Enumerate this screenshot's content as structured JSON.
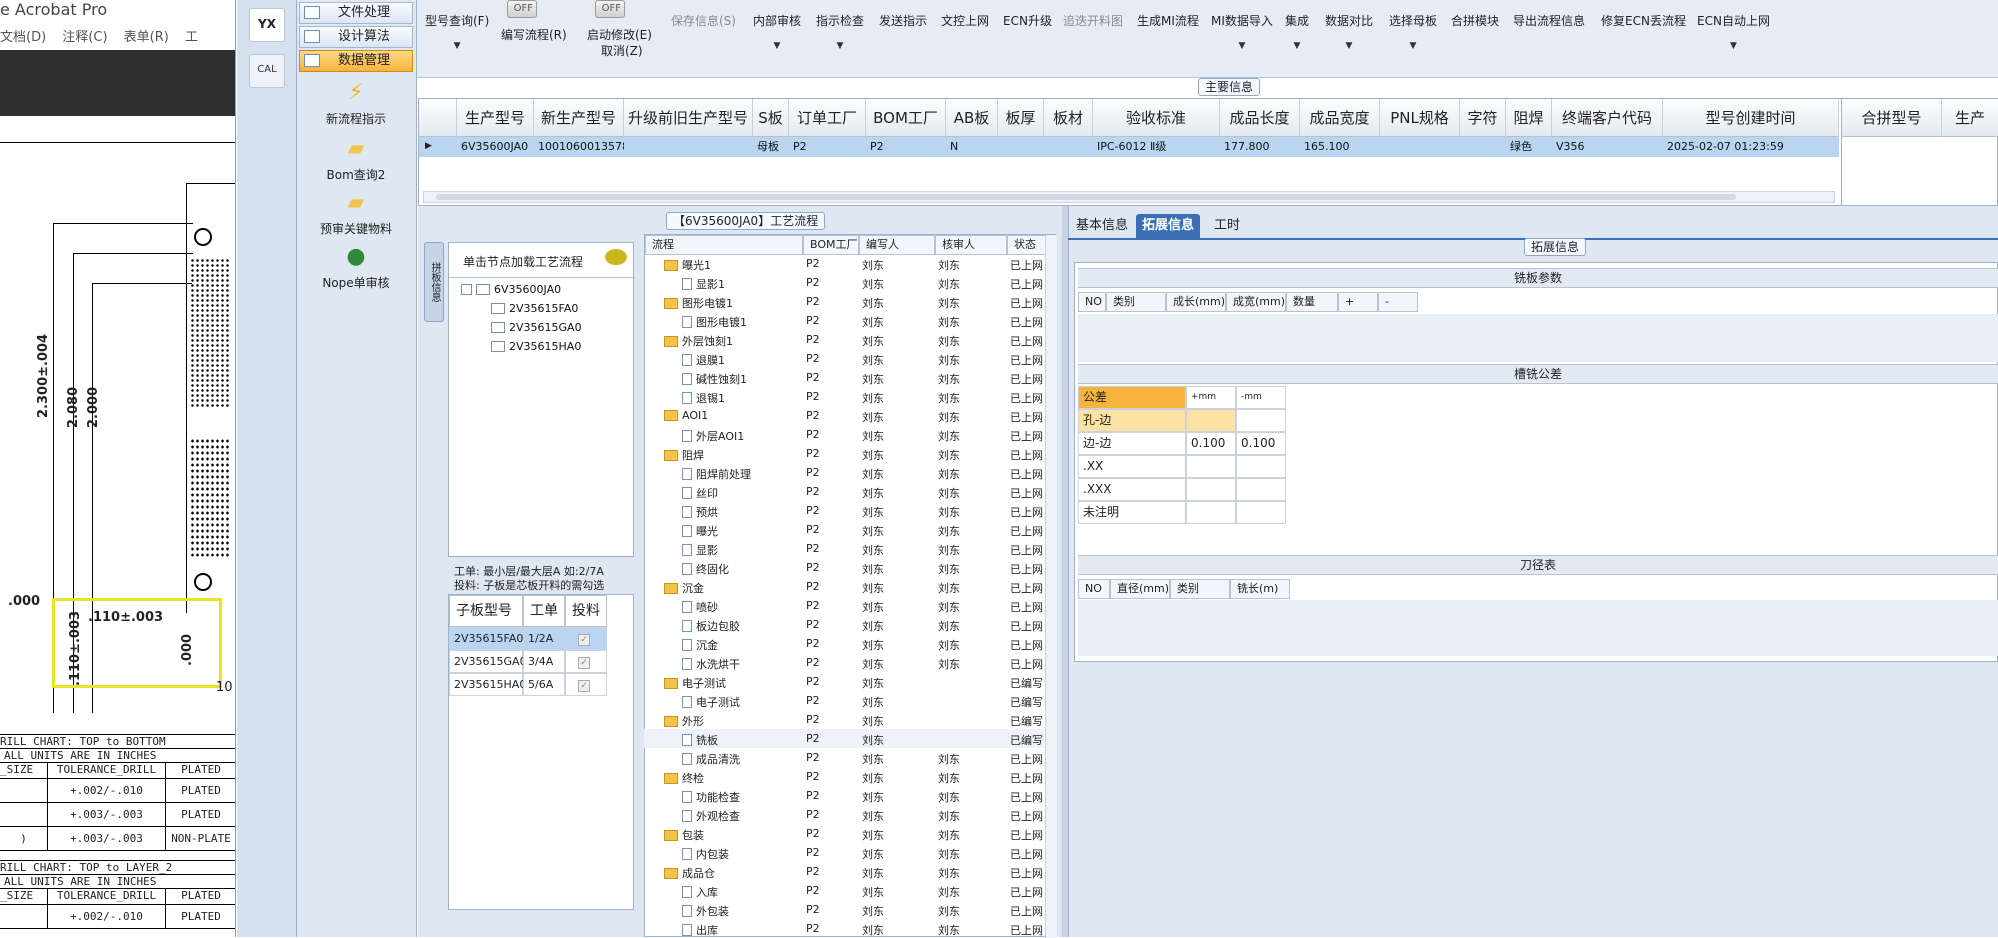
{
  "acrobat": {
    "title": "e Acrobat Pro",
    "menu": [
      "文档(D)",
      "注释(C)",
      "表单(R)",
      "工"
    ],
    "dims": {
      "d1": "2.300±.004",
      "d2": "2.080",
      "d3": "2.000",
      "d4": ".000",
      "d5": ".110±.003",
      "d6": ".110±.003",
      "d7": ".000",
      "d8": "10"
    },
    "chart1": {
      "title": "RILL CHART: TOP to BOTTOM",
      "units": "ALL UNITS ARE IN INCHES",
      "headers": [
        "_SIZE",
        "TOLERANCE_DRILL",
        "PLATED"
      ],
      "rows": [
        [
          "",
          "+.002/-.010",
          "PLATED"
        ],
        [
          "",
          "+.003/-.003",
          "PLATED"
        ],
        [
          ")",
          "+.003/-.003",
          "NON-PLATE"
        ]
      ]
    },
    "chart2": {
      "title": "RILL CHART: TOP to LAYER_2",
      "units": "ALL UNITS ARE IN INCHES",
      "headers": [
        "_SIZE",
        "TOLERANCE_DRILL",
        "PLATED"
      ],
      "rows": [
        [
          "",
          "+.002/-.010",
          "PLATED"
        ]
      ]
    }
  },
  "launcher": {
    "yx": "YX",
    "calc": "CAL"
  },
  "nav": {
    "buttons": [
      "文件处理",
      "设计算法",
      "数据管理"
    ],
    "tools": [
      "新流程指示",
      "Bom查询2",
      "预审关键物料",
      "Nope单审核"
    ]
  },
  "toolbar": {
    "items": [
      "型号查询(F)",
      "编写流程(R)",
      "启动修改(E)",
      "取消(Z)",
      "保存信息(S)",
      "内部审核",
      "指示检查",
      "发送指示",
      "文控上网",
      "ECN升级",
      "追迭开料图",
      "生成MI流程",
      "MI数据导入",
      "集成",
      "数据对比",
      "选择母板",
      "合拼模块",
      "导出流程信息",
      "修复ECN丢流程",
      "ECN自动上网"
    ],
    "toggle": "OFF"
  },
  "main": {
    "title": "主要信息",
    "headers": [
      "生产型号",
      "新生产型号",
      "升级前旧生产型号",
      "S板",
      "订单工厂",
      "BOM工厂",
      "AB板",
      "板厚",
      "板材",
      "验收标准",
      "成品长度",
      "成品宽度",
      "PNL规格",
      "字符",
      "阻焊",
      "终端客户代码",
      "型号创建时间"
    ],
    "row": [
      "6V35600JA0",
      "10010600135780",
      "",
      "母板",
      "P2",
      "P2",
      "N",
      "",
      "",
      "IPC-6012 Ⅱ级",
      "177.800",
      "165.100",
      "",
      "",
      "绿色",
      "V356",
      "2025-02-07 01:23:59"
    ],
    "right_headers": [
      "合拼型号",
      "生产"
    ]
  },
  "process": {
    "title": "【6V35600JA0】工艺流程",
    "hint": "单击节点加载工艺流程",
    "sidetab": "拼板信息",
    "tree_root": "6V35600JA0",
    "tree_children": [
      "2V35615FA0",
      "2V35615GA0",
      "2V35615HA0"
    ],
    "info1": "工单: 最小层/最大层A 如:2/7A",
    "info2": "投料: 子板是芯板开料的需勾选",
    "sub_headers": [
      "子板型号",
      "工单",
      "投料"
    ],
    "sub_rows": [
      [
        "2V35615FA0",
        "1/2A"
      ],
      [
        "2V35615GA0",
        "3/4A"
      ],
      [
        "2V35615HA0",
        "5/6A"
      ]
    ],
    "flow_headers": [
      "流程",
      "BOM工厂",
      "编写人",
      "核审人",
      "状态"
    ],
    "flow_rows": [
      {
        "t": "f",
        "n": "曝光1",
        "b": "P2",
        "w": "刘东",
        "r": "刘东",
        "s": "已上网"
      },
      {
        "t": "d",
        "n": "显影1",
        "b": "P2",
        "w": "刘东",
        "r": "刘东",
        "s": "已上网"
      },
      {
        "t": "f",
        "n": "图形电镀1",
        "b": "P2",
        "w": "刘东",
        "r": "刘东",
        "s": "已上网"
      },
      {
        "t": "d",
        "n": "图形电镀1",
        "b": "P2",
        "w": "刘东",
        "r": "刘东",
        "s": "已上网"
      },
      {
        "t": "f",
        "n": "外层蚀刻1",
        "b": "P2",
        "w": "刘东",
        "r": "刘东",
        "s": "已上网"
      },
      {
        "t": "d",
        "n": "退膜1",
        "b": "P2",
        "w": "刘东",
        "r": "刘东",
        "s": "已上网"
      },
      {
        "t": "d",
        "n": "碱性蚀刻1",
        "b": "P2",
        "w": "刘东",
        "r": "刘东",
        "s": "已上网"
      },
      {
        "t": "d",
        "n": "退锡1",
        "b": "P2",
        "w": "刘东",
        "r": "刘东",
        "s": "已上网"
      },
      {
        "t": "f",
        "n": "AOI1",
        "b": "P2",
        "w": "刘东",
        "r": "刘东",
        "s": "已上网"
      },
      {
        "t": "d",
        "n": "外层AOI1",
        "b": "P2",
        "w": "刘东",
        "r": "刘东",
        "s": "已上网"
      },
      {
        "t": "f",
        "n": "阻焊",
        "b": "P2",
        "w": "刘东",
        "r": "刘东",
        "s": "已上网"
      },
      {
        "t": "d",
        "n": "阻焊前处理",
        "b": "P2",
        "w": "刘东",
        "r": "刘东",
        "s": "已上网"
      },
      {
        "t": "d",
        "n": "丝印",
        "b": "P2",
        "w": "刘东",
        "r": "刘东",
        "s": "已上网"
      },
      {
        "t": "d",
        "n": "预烘",
        "b": "P2",
        "w": "刘东",
        "r": "刘东",
        "s": "已上网"
      },
      {
        "t": "d",
        "n": "曝光",
        "b": "P2",
        "w": "刘东",
        "r": "刘东",
        "s": "已上网"
      },
      {
        "t": "d",
        "n": "显影",
        "b": "P2",
        "w": "刘东",
        "r": "刘东",
        "s": "已上网"
      },
      {
        "t": "d",
        "n": "终固化",
        "b": "P2",
        "w": "刘东",
        "r": "刘东",
        "s": "已上网"
      },
      {
        "t": "f",
        "n": "沉金",
        "b": "P2",
        "w": "刘东",
        "r": "刘东",
        "s": "已上网"
      },
      {
        "t": "d",
        "n": "喷砂",
        "b": "P2",
        "w": "刘东",
        "r": "刘东",
        "s": "已上网"
      },
      {
        "t": "d",
        "n": "板边包胶",
        "b": "P2",
        "w": "刘东",
        "r": "刘东",
        "s": "已上网"
      },
      {
        "t": "d",
        "n": "沉金",
        "b": "P2",
        "w": "刘东",
        "r": "刘东",
        "s": "已上网"
      },
      {
        "t": "d",
        "n": "水洗烘干",
        "b": "P2",
        "w": "刘东",
        "r": "刘东",
        "s": "已上网"
      },
      {
        "t": "f",
        "n": "电子测试",
        "b": "P2",
        "w": "刘东",
        "r": "",
        "s": "已编写"
      },
      {
        "t": "d",
        "n": "电子测试",
        "b": "P2",
        "w": "刘东",
        "r": "",
        "s": "已编写"
      },
      {
        "t": "f",
        "n": "外形",
        "b": "P2",
        "w": "刘东",
        "r": "",
        "s": "已编写"
      },
      {
        "t": "d",
        "n": "铣板",
        "b": "P2",
        "w": "刘东",
        "r": "",
        "s": "已编写"
      },
      {
        "t": "d",
        "n": "成品清洗",
        "b": "P2",
        "w": "刘东",
        "r": "刘东",
        "s": "已上网"
      },
      {
        "t": "f",
        "n": "终检",
        "b": "P2",
        "w": "刘东",
        "r": "刘东",
        "s": "已上网"
      },
      {
        "t": "d",
        "n": "功能检查",
        "b": "P2",
        "w": "刘东",
        "r": "刘东",
        "s": "已上网"
      },
      {
        "t": "d",
        "n": "外观检查",
        "b": "P2",
        "w": "刘东",
        "r": "刘东",
        "s": "已上网"
      },
      {
        "t": "f",
        "n": "包装",
        "b": "P2",
        "w": "刘东",
        "r": "刘东",
        "s": "已上网"
      },
      {
        "t": "d",
        "n": "内包装",
        "b": "P2",
        "w": "刘东",
        "r": "刘东",
        "s": "已上网"
      },
      {
        "t": "f",
        "n": "成品仓",
        "b": "P2",
        "w": "刘东",
        "r": "刘东",
        "s": "已上网"
      },
      {
        "t": "d",
        "n": "入库",
        "b": "P2",
        "w": "刘东",
        "r": "刘东",
        "s": "已上网"
      },
      {
        "t": "d",
        "n": "外包装",
        "b": "P2",
        "w": "刘东",
        "r": "刘东",
        "s": "已上网"
      },
      {
        "t": "d",
        "n": "出库",
        "b": "P2",
        "w": "刘东",
        "r": "刘东",
        "s": "已上网"
      }
    ]
  },
  "ext": {
    "tabs": [
      "基本信息",
      "拓展信息",
      "工时"
    ],
    "title": "拓展信息",
    "mill": {
      "title": "铣板参数",
      "headers": [
        "NO",
        "类别",
        "成长(mm)",
        "成宽(mm)",
        "数量",
        "+",
        "-"
      ]
    },
    "tol": {
      "title": "槽铣公差",
      "headers": [
        "公差",
        "+mm",
        "-mm"
      ],
      "rows": [
        [
          "孔-边",
          "",
          ""
        ],
        [
          "边-边",
          "0.100",
          "0.100"
        ],
        [
          ".XX",
          "",
          ""
        ],
        [
          ".XXX",
          "",
          ""
        ],
        [
          "未注明",
          "",
          ""
        ]
      ]
    },
    "tool": {
      "title": "刀径表",
      "headers": [
        "NO",
        "直径(mm)",
        "类别",
        "铣长(m)"
      ]
    }
  },
  "colors": {
    "accent": "#3b6fb4",
    "selected": "#b9d5f2",
    "nav_active": "#f7b33b",
    "highlight": "#e8e326"
  }
}
